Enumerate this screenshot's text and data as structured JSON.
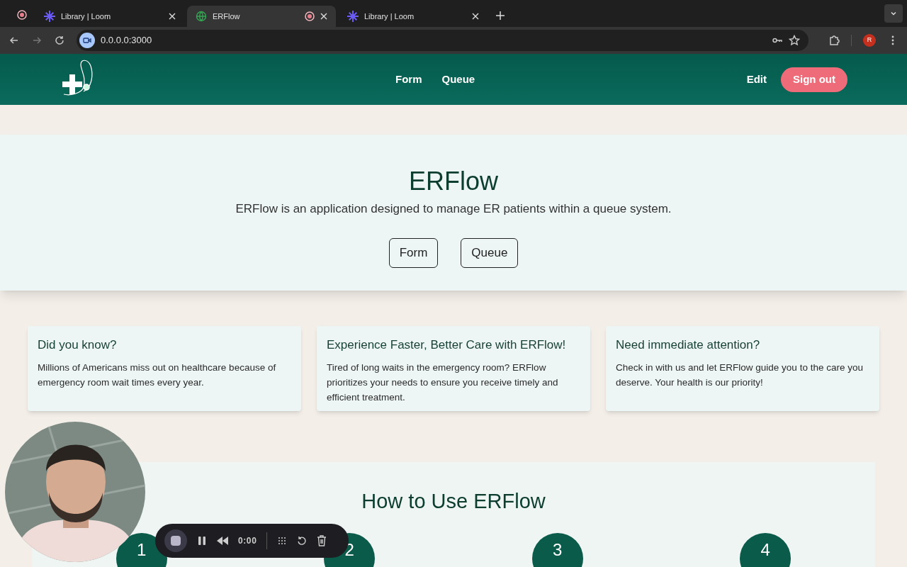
{
  "browser": {
    "tabs": [
      {
        "title": "Library | Loom",
        "kind": "loom",
        "selected": false,
        "recording": false
      },
      {
        "title": "ERFlow",
        "kind": "globe",
        "selected": true,
        "recording": true
      },
      {
        "title": "Library | Loom",
        "kind": "loom",
        "selected": false,
        "recording": false
      }
    ],
    "address": "0.0.0.0:3000",
    "profile_initial": "R"
  },
  "header": {
    "nav": [
      "Form",
      "Queue"
    ],
    "edit": "Edit",
    "sign_out": "Sign out"
  },
  "hero": {
    "title": "ERFlow",
    "subtitle": "ERFlow is an application designed to manage ER patients within a queue system.",
    "buttons": [
      "Form",
      "Queue"
    ]
  },
  "cards": [
    {
      "title": "Did you know?",
      "text": "Millions of Americans miss out on healthcare because of emergency room wait times every year."
    },
    {
      "title": "Experience Faster, Better Care with ERFlow!",
      "text": "Tired of long waits in the emergency room? ERFlow prioritizes your needs to ensure you receive timely and efficient treatment."
    },
    {
      "title": "Need immediate attention?",
      "text": "Check in with us and let ERFlow guide you to the care you deserve. Your health is our priority!"
    }
  ],
  "how_to": {
    "title": "How to Use ERFlow",
    "steps": [
      "1",
      "2",
      "3",
      "4"
    ]
  },
  "recorder": {
    "time": "0:00"
  }
}
